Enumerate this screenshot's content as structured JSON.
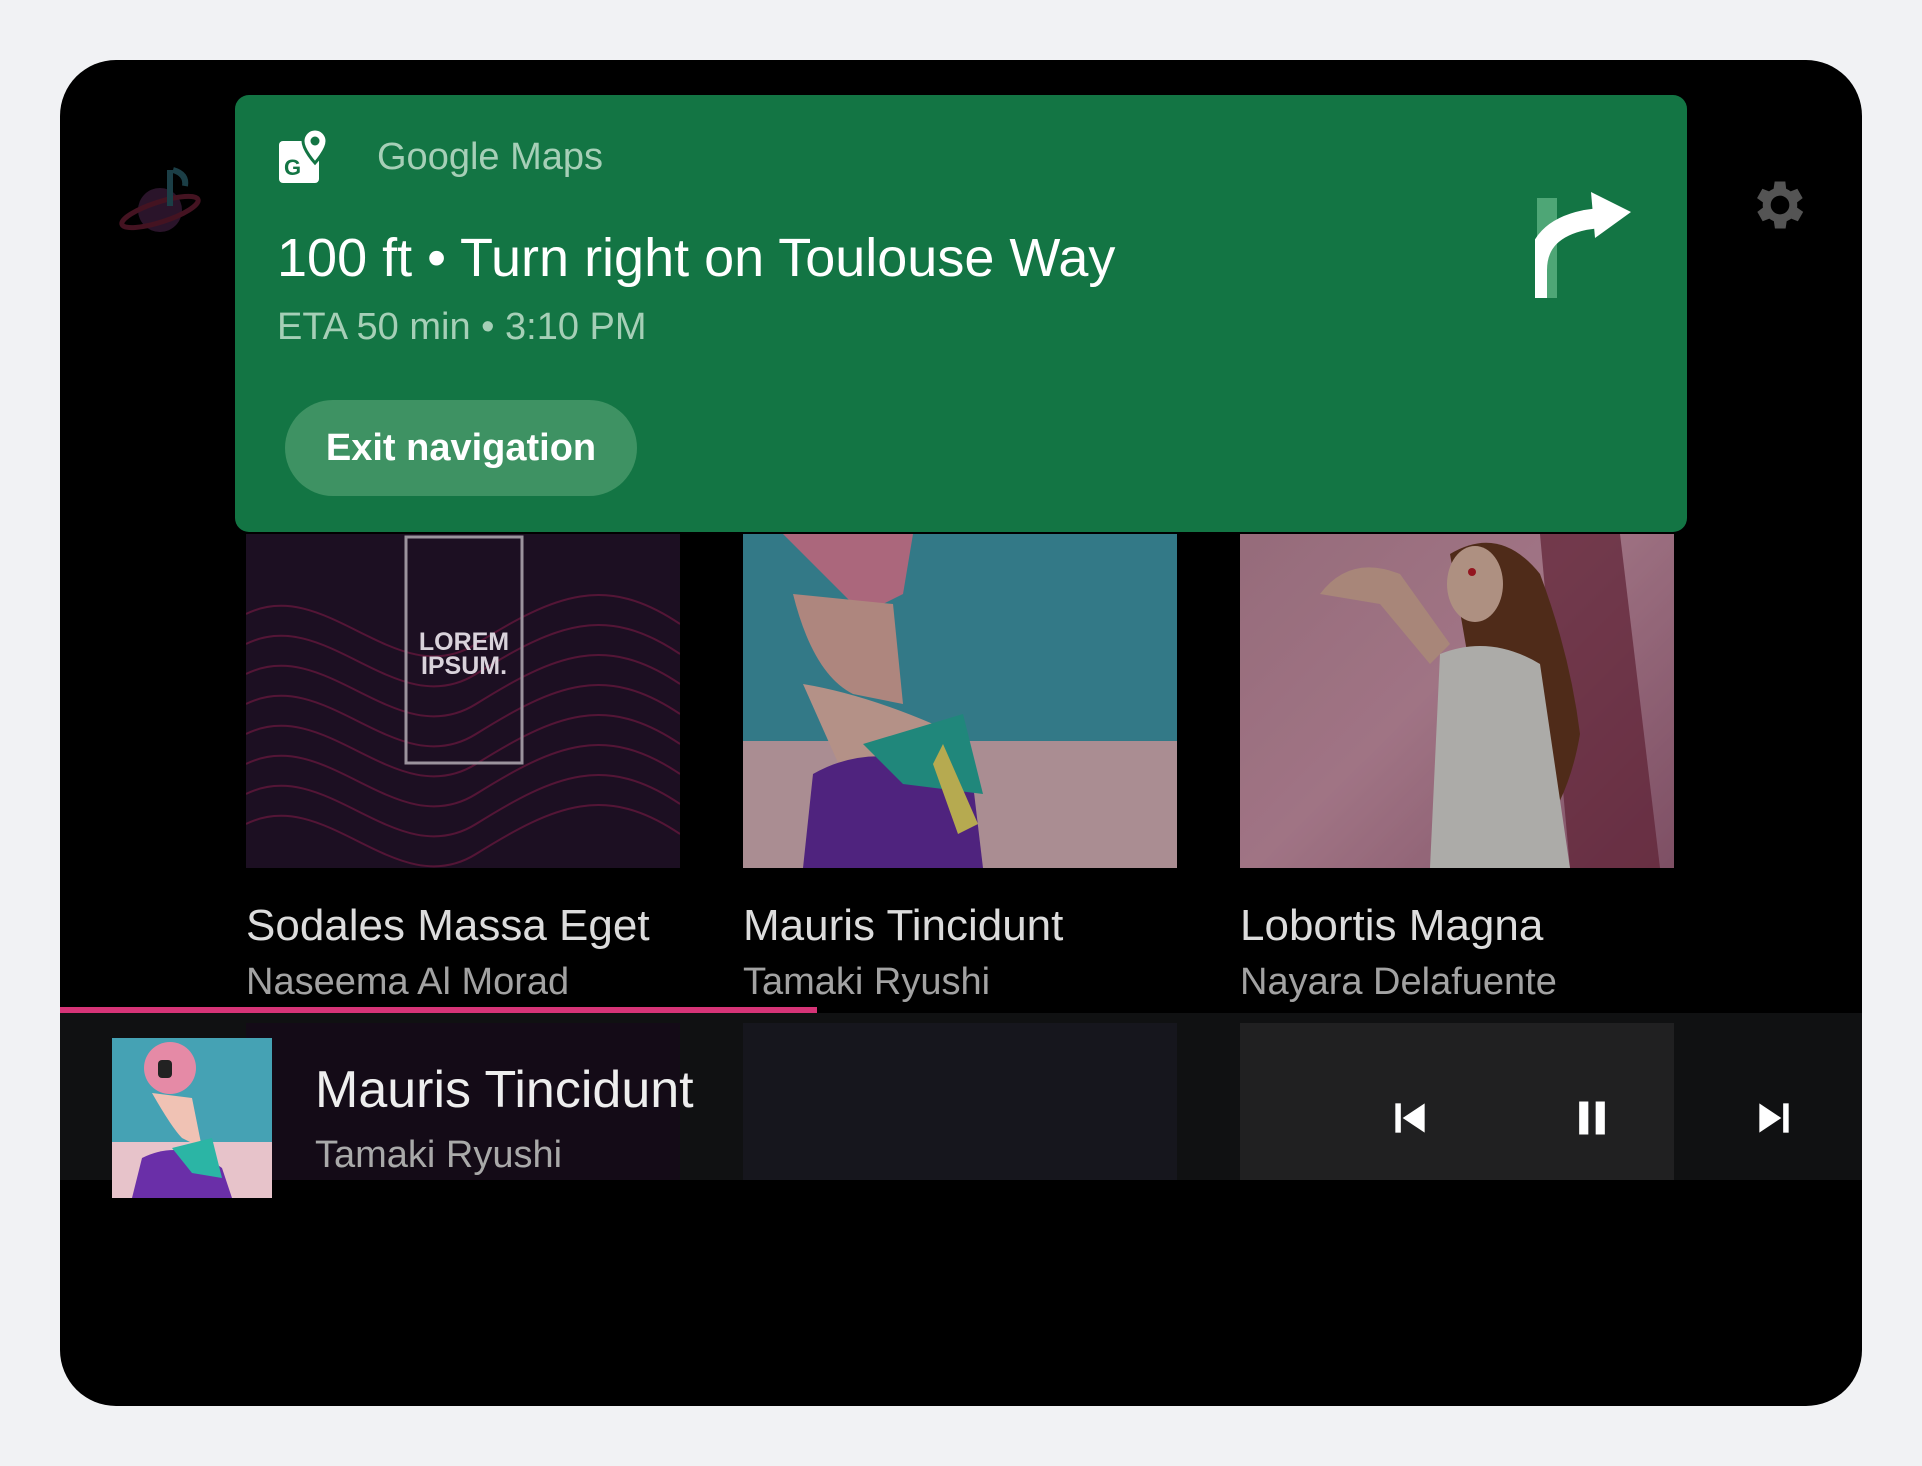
{
  "app": {
    "logo_icon": "music-planet-icon",
    "settings_icon": "gear-icon"
  },
  "albums": [
    {
      "title": "Sodales Massa Eget",
      "artist": "Naseema Al Morad",
      "art_text": "LOREM IPSUM."
    },
    {
      "title": "Mauris Tincidunt",
      "artist": "Tamaki Ryushi"
    },
    {
      "title": "Lobortis Magna",
      "artist": "Nayara Delafuente"
    }
  ],
  "navigation": {
    "app_name": "Google Maps",
    "app_icon": "google-maps-icon",
    "instruction": "100 ft • Turn right on Toulouse Way",
    "eta": "ETA 50 min • 3:10 PM",
    "exit_label": "Exit navigation",
    "maneuver_icon": "turn-right-icon",
    "color": "#137544"
  },
  "now_playing": {
    "title": "Mauris Tincidunt",
    "artist": "Tamaki Ryushi",
    "progress": 0.42,
    "progress_color": "#d63477",
    "controls": [
      "skip-previous-icon",
      "pause-icon",
      "skip-next-icon"
    ]
  }
}
